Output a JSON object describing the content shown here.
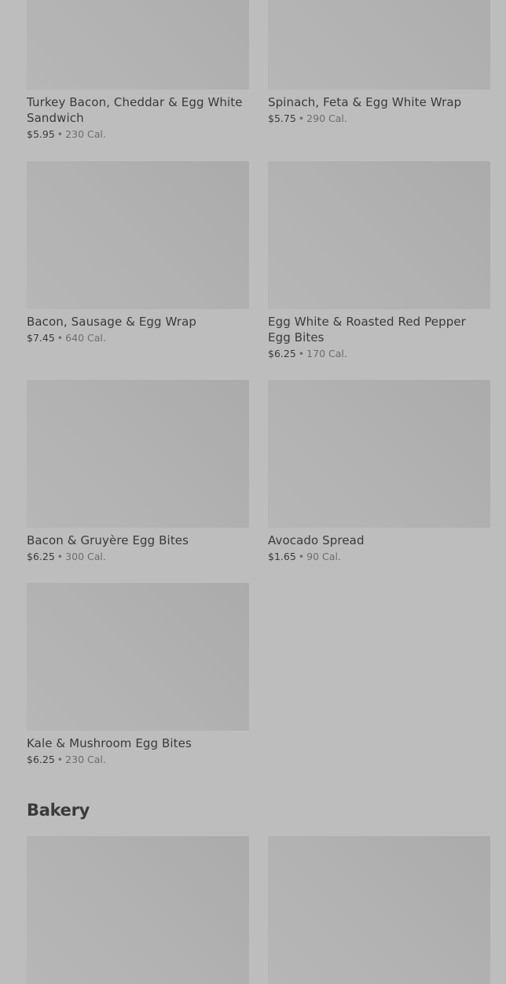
{
  "menu_items": [
    {
      "name": "Turkey Bacon, Cheddar & Egg White Sandwich",
      "price": "$5.95",
      "calories": "230 Cal."
    },
    {
      "name": "Spinach, Feta & Egg White Wrap",
      "price": "$5.75",
      "calories": "290 Cal."
    },
    {
      "name": "Bacon, Sausage & Egg Wrap",
      "price": "$7.45",
      "calories": "640 Cal."
    },
    {
      "name": "Egg White & Roasted Red Pepper Egg Bites",
      "price": "$6.25",
      "calories": "170 Cal."
    },
    {
      "name": "Bacon & Gruyère Egg Bites",
      "price": "$6.25",
      "calories": "300 Cal."
    },
    {
      "name": "Avocado Spread",
      "price": "$1.65",
      "calories": "90 Cal."
    },
    {
      "name": "Kale & Mushroom Egg Bites",
      "price": "$6.25",
      "calories": "230 Cal."
    }
  ],
  "separator": "•",
  "sections": {
    "bakery_title": "Bakery"
  },
  "colors": {
    "background": "#bdbdbd",
    "image_placeholder": "#b2b2b2",
    "text_primary": "#3b3b3b",
    "text_secondary": "#6e6e6e"
  }
}
